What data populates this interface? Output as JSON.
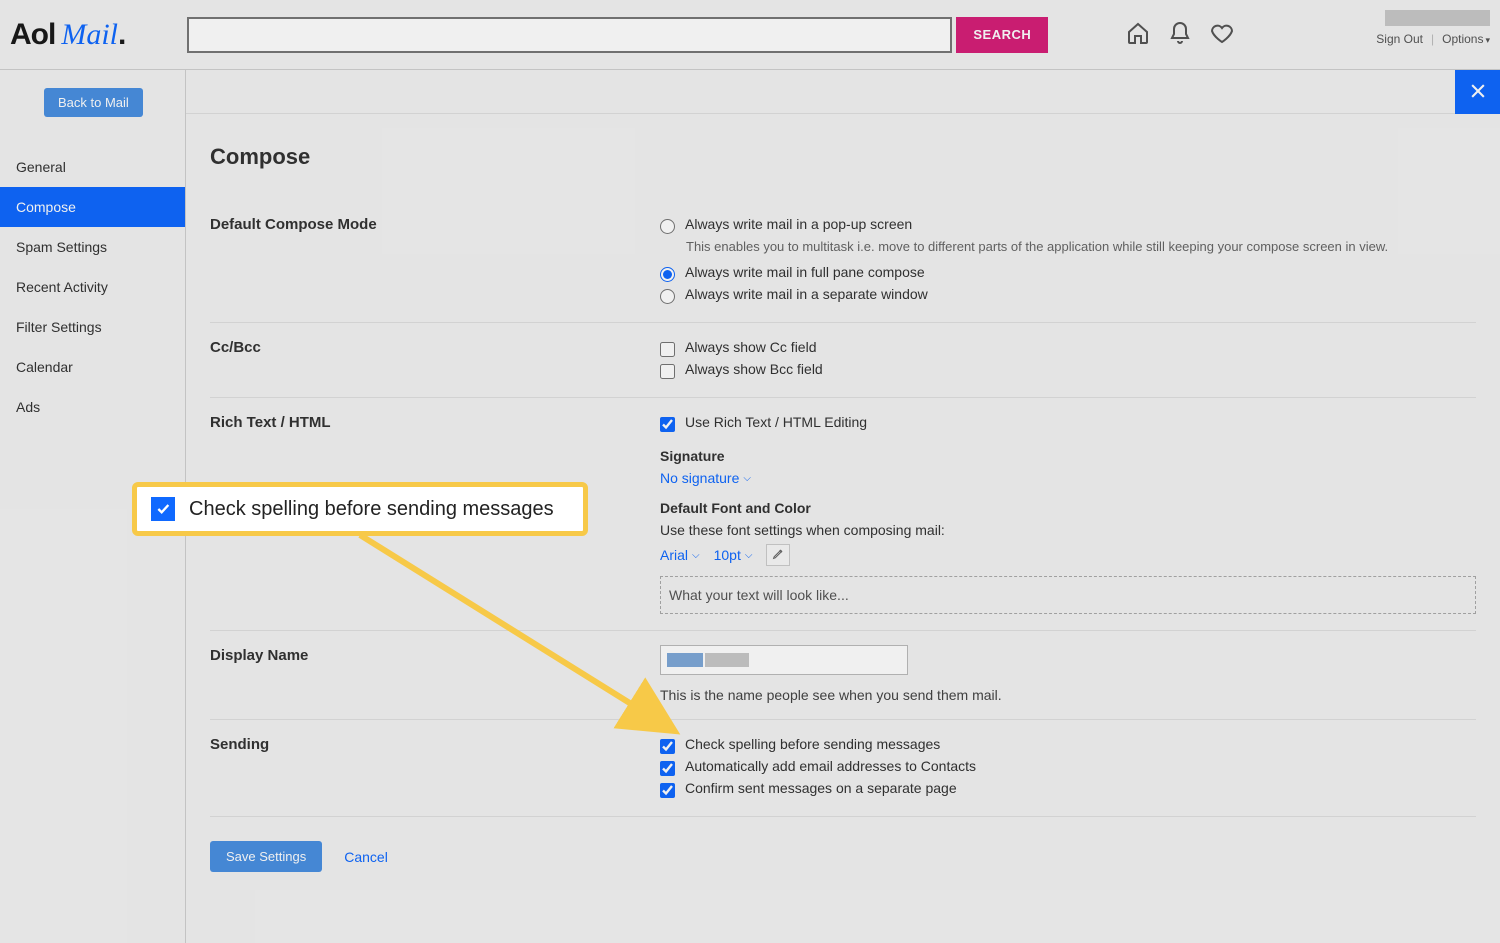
{
  "brand": {
    "aol": "Aol",
    "mail": "Mail",
    "dot": "."
  },
  "header": {
    "search_placeholder": "",
    "search_button": "SEARCH",
    "sign_out": "Sign Out",
    "options": "Options"
  },
  "sidebar": {
    "back_button": "Back to Mail",
    "items": [
      {
        "label": "General"
      },
      {
        "label": "Compose"
      },
      {
        "label": "Spam Settings"
      },
      {
        "label": "Recent Activity"
      },
      {
        "label": "Filter Settings"
      },
      {
        "label": "Calendar"
      },
      {
        "label": "Ads"
      }
    ],
    "active_index": 1
  },
  "page": {
    "title": "Compose"
  },
  "compose_mode": {
    "label": "Default Compose Mode",
    "options": {
      "popup": "Always write mail in a pop-up screen",
      "popup_desc": "This enables you to multitask i.e. move to different parts of the application while still keeping your compose screen in view.",
      "full_pane": "Always write mail in full pane compose",
      "separate": "Always write mail in a separate window"
    }
  },
  "ccbcc": {
    "label": "Cc/Bcc",
    "show_cc": "Always show Cc field",
    "show_bcc": "Always show Bcc field"
  },
  "richtext": {
    "label": "Rich Text / HTML",
    "use_richtext": "Use Rich Text / HTML Editing",
    "signature_heading": "Signature",
    "signature_value": "No signature",
    "font_heading": "Default Font and Color",
    "font_hint": "Use these font settings when composing mail:",
    "font_name": "Arial",
    "font_size": "10pt",
    "preview": "What your text will look like..."
  },
  "displayname": {
    "label": "Display Name",
    "hint": "This is the name people see when you send them mail."
  },
  "sending": {
    "label": "Sending",
    "check_spelling": "Check spelling before sending messages",
    "auto_add": "Automatically add email addresses to Contacts",
    "confirm_sent": "Confirm sent messages on a separate page"
  },
  "footer": {
    "save": "Save Settings",
    "cancel": "Cancel"
  },
  "callout": {
    "label": "Check spelling before sending messages"
  }
}
